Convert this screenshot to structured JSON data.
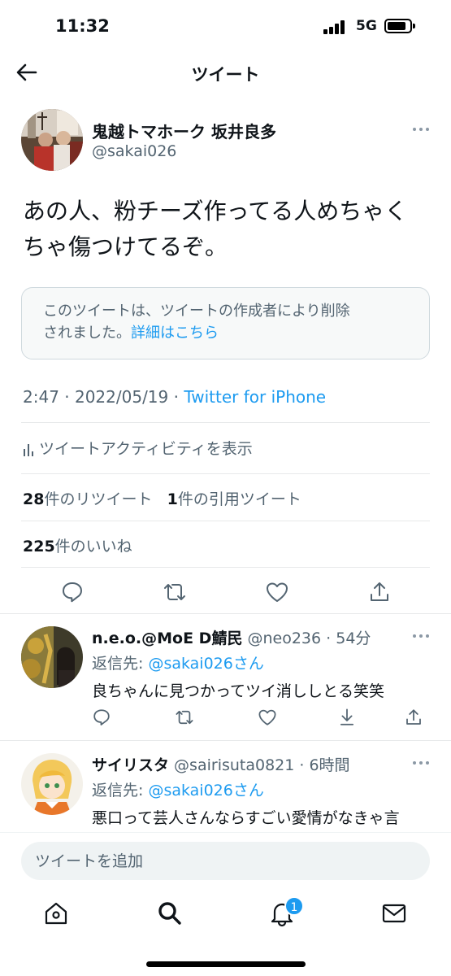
{
  "status_bar": {
    "time": "11:32",
    "network": "5G"
  },
  "header": {
    "title": "ツイート"
  },
  "tweet": {
    "author_name": "鬼越トマホーク 坂井良多",
    "author_handle": "@sakai026",
    "text_line1": "あの人、粉チーズ作ってる人めちゃく",
    "text_line2": "ちゃ傷つけてるぞ。",
    "notice_line1": "このツイートは、ツイートの作成者により削除",
    "notice_line2": "されました。",
    "notice_link": "詳細はこちら",
    "timestamp": "2:47 · 2022/05/19 · ",
    "source": "Twitter for iPhone",
    "activity_label": "ツイートアクティビティを表示",
    "retweet_count": "28",
    "retweet_label": "件のリツイート",
    "quote_count": "1",
    "quote_label": "件の引用ツイート",
    "like_count": "225",
    "like_label": "件のいいね"
  },
  "replies": [
    {
      "name": "n.e.o.@MoE D鯖民",
      "handle_time": " @neo236 · 54分",
      "reply_to_label": "返信先: ",
      "reply_to_handle": "@sakai026さん",
      "text": "良ちゃんに見つかってツイ消ししとる笑笑"
    },
    {
      "name": "サイリスタ",
      "handle_time": " @sairisuta0821 · 6時間",
      "reply_to_label": "返信先: ",
      "reply_to_handle": "@sakai026さん",
      "text": "悪口って芸人さんならすごい愛情がなきゃ言"
    }
  ],
  "compose": {
    "placeholder": "ツイートを追加"
  },
  "tabbar": {
    "notification_badge": "1"
  },
  "colors": {
    "accent": "#1d9bf0",
    "secondary_text": "#536471",
    "border": "#e7e9ea"
  }
}
